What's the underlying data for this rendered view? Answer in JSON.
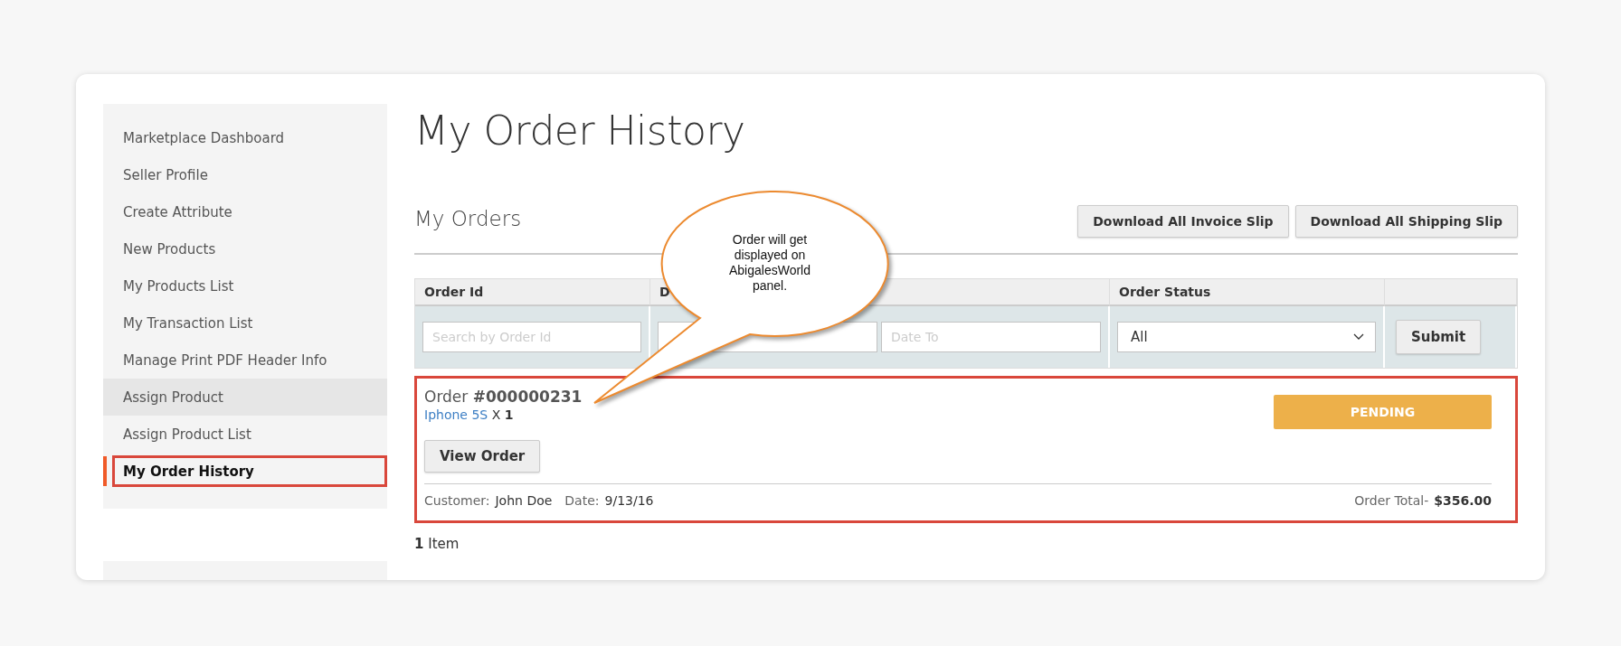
{
  "sidebar": {
    "items": [
      {
        "label": "Marketplace Dashboard",
        "selected": false,
        "hovered": false,
        "annotated": false
      },
      {
        "label": "Seller Profile",
        "selected": false,
        "hovered": false,
        "annotated": false
      },
      {
        "label": "Create Attribute",
        "selected": false,
        "hovered": false,
        "annotated": false
      },
      {
        "label": "New Products",
        "selected": false,
        "hovered": false,
        "annotated": false
      },
      {
        "label": "My Products List",
        "selected": false,
        "hovered": false,
        "annotated": false
      },
      {
        "label": "My Transaction List",
        "selected": false,
        "hovered": false,
        "annotated": false
      },
      {
        "label": "Manage Print PDF Header Info",
        "selected": false,
        "hovered": false,
        "annotated": false
      },
      {
        "label": "Assign Product",
        "selected": false,
        "hovered": true,
        "annotated": false
      },
      {
        "label": "Assign Product List",
        "selected": false,
        "hovered": false,
        "annotated": false
      },
      {
        "label": "My Order History",
        "selected": true,
        "hovered": false,
        "annotated": true
      }
    ]
  },
  "page_title": "My Order History",
  "section_title": "My Orders",
  "buttons": [
    "Download All Invoice Slip",
    "Download All Shipping Slip"
  ],
  "filter_table": {
    "columns": [
      "Order Id",
      "D",
      "Order Status"
    ],
    "order_id_placeholder": "Search by Order Id",
    "date_to_placeholder": "Date To",
    "status_value": "All",
    "submit": "Submit"
  },
  "orders": [
    {
      "annotated": true,
      "label": "Order **#000000231**",
      "product": "Iphone 5S",
      "quantity": "X **1**",
      "status": "PENDING",
      "view_button": "View Order",
      "customer_label": "Customer:",
      "customer": "John Doe",
      "date_label": "Date:",
      "date": "9/13/16",
      "total_label": "Order Total-",
      "total": "$356.00"
    }
  ],
  "item_count": "**1** Item",
  "callout": {
    "text": "Order will get displayed on AbigalesWorld panel."
  }
}
